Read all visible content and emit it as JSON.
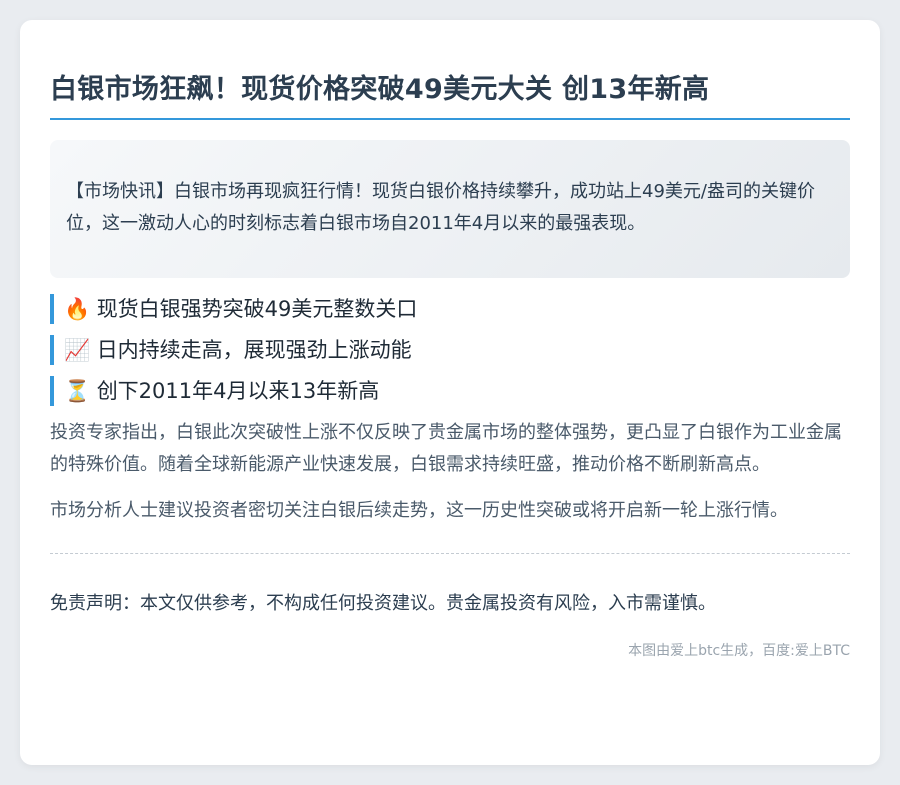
{
  "article": {
    "title": "白银市场狂飙！现货价格突破49美元大关 创13年新高",
    "lead": "【市场快讯】白银市场再现疯狂行情！现货白银价格持续攀升，成功站上49美元/盎司的关键价位，这一激动人心的时刻标志着白银市场自2011年4月以来的最强表现。",
    "points": [
      {
        "icon": "fire-icon",
        "emoji": "🔥",
        "text": "现货白银强势突破49美元整数关口"
      },
      {
        "icon": "chart-increasing-icon",
        "emoji": "📈",
        "text": "日内持续走高，展现强劲上涨动能"
      },
      {
        "icon": "hourglass-icon",
        "emoji": "⏳",
        "text": "创下2011年4月以来13年新高"
      }
    ],
    "paragraphs": [
      "投资专家指出，白银此次突破性上涨不仅反映了贵金属市场的整体强势，更凸显了白银作为工业金属的特殊价值。随着全球新能源产业快速发展，白银需求持续旺盛，推动价格不断刷新高点。",
      "市场分析人士建议投资者密切关注白银后续走势，这一历史性突破或将开启新一轮上涨行情。"
    ],
    "disclaimer": "免责声明：本文仅供参考，不构成任何投资建议。贵金属投资有风险，入市需谨慎。",
    "footer": "本图由爱上btc生成，百度:爱上BTC"
  },
  "colors": {
    "accent": "#3498db",
    "page_background": "#e9ecf0",
    "card_background": "#ffffff",
    "title_text": "#2c3e50"
  }
}
